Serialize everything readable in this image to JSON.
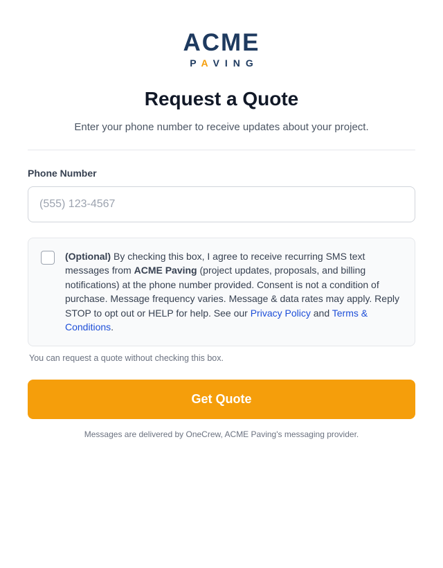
{
  "brand": {
    "name_main": "ACME",
    "name_sub_before": "P",
    "name_sub_accent": "A",
    "name_sub_after": "VING",
    "primary_color": "#1e3a5f",
    "accent_color": "#f59e0b"
  },
  "header": {
    "title": "Request a Quote",
    "subtitle": "Enter your phone number to receive updates about your project."
  },
  "form": {
    "phone_label": "Phone Number",
    "phone_placeholder": "(555) 123-4567",
    "phone_value": "",
    "consent": {
      "checked": false,
      "optional_tag": "(Optional)",
      "text_1": " By checking this box, I agree to receive recurring SMS text messages from ",
      "company": "ACME Paving",
      "text_2": " (project updates, proposals, and billing notifications) at the phone number provided. Consent is not a condition of purchase. Message frequency varies. Message & data rates may apply. Reply STOP to opt out or HELP for help. See our ",
      "privacy_link": "Privacy Policy",
      "text_3": " and ",
      "terms_link": "Terms & Conditions",
      "text_4": "."
    },
    "helper_text": "You can request a quote without checking this box.",
    "submit_label": "Get Quote",
    "submit_color": "#f59e0b"
  },
  "footer": {
    "note": "Messages are delivered by OneCrew, ACME Paving's messaging provider."
  }
}
